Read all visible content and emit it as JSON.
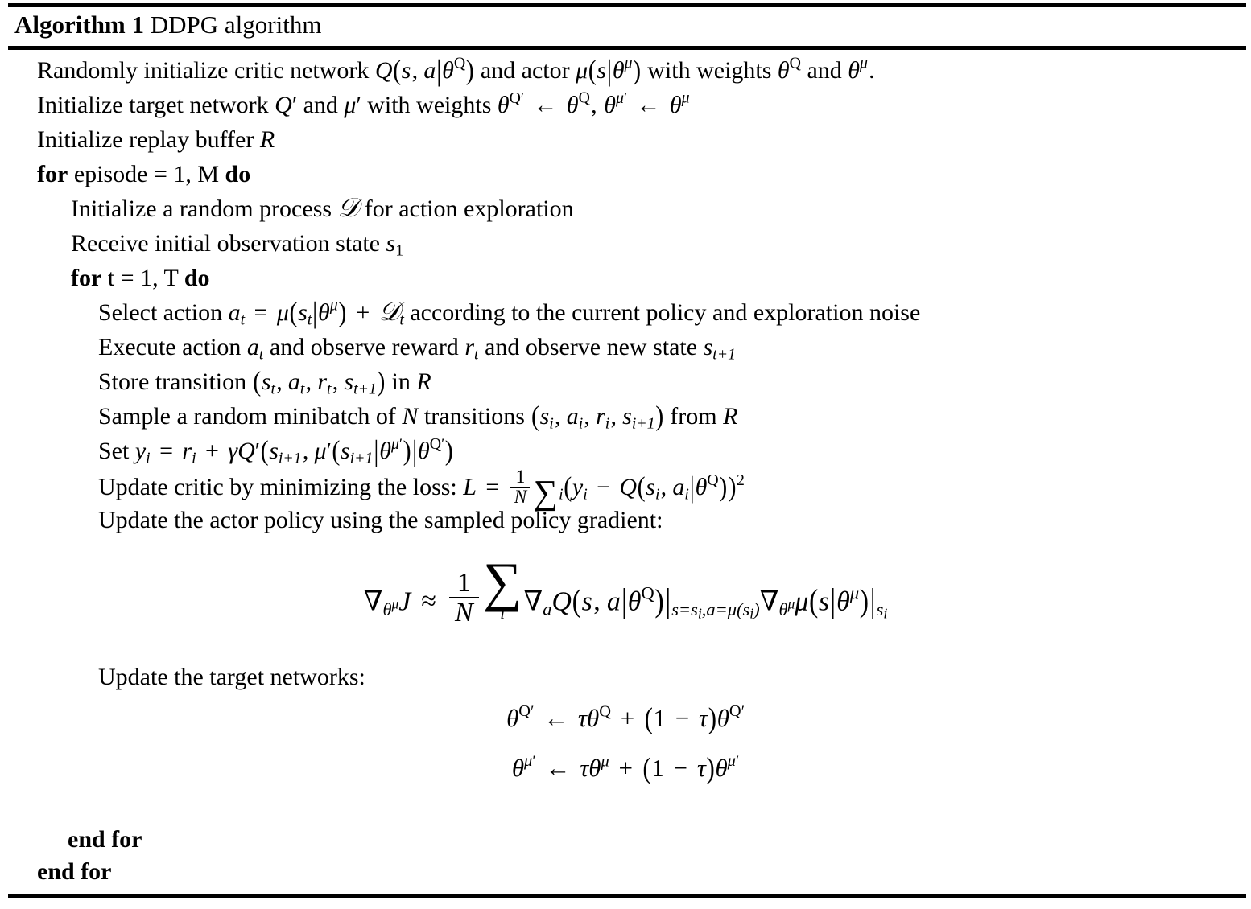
{
  "algorithm": {
    "number_label": "Algorithm 1",
    "title": "DDPG algorithm",
    "caption_full": "Algorithm 1 DDPG algorithm",
    "lines": [
      {
        "indent": 0,
        "id": "init-critic",
        "text": "Randomly initialize critic network Q(s, a|θ^Q) and actor μ(s|θ^μ) with weights θ^Q and θ^μ."
      },
      {
        "indent": 0,
        "id": "init-target",
        "text": "Initialize target network Q′ and μ′ with weights θ^Q′ ← θ^Q, θ^μ′ ← θ^μ"
      },
      {
        "indent": 0,
        "id": "init-replay",
        "text": "Initialize replay buffer R"
      },
      {
        "indent": 0,
        "id": "for-episode",
        "text": "for episode = 1, M do",
        "keywords": [
          "for",
          "do"
        ],
        "loop_var": "episode",
        "loop_from": "1",
        "loop_to": "M"
      },
      {
        "indent": 1,
        "id": "init-noise",
        "text": "Initialize a random process 𝒩 for action exploration"
      },
      {
        "indent": 1,
        "id": "receive-state",
        "text": "Receive initial observation state s₁"
      },
      {
        "indent": 1,
        "id": "for-t",
        "text": "for t = 1, T do",
        "keywords": [
          "for",
          "do"
        ],
        "loop_var": "t",
        "loop_from": "1",
        "loop_to": "T"
      },
      {
        "indent": 2,
        "id": "select-action",
        "text": "Select action a_t = μ(s_t|θ^μ) + 𝒩_t according to the current policy and exploration noise"
      },
      {
        "indent": 2,
        "id": "execute-action",
        "text": "Execute action a_t and observe reward r_t and observe new state s_{t+1}"
      },
      {
        "indent": 2,
        "id": "store-transition",
        "text": "Store transition (s_t, a_t, r_t, s_{t+1}) in R"
      },
      {
        "indent": 2,
        "id": "sample-minibatch",
        "text": "Sample a random minibatch of N transitions (s_i, a_i, r_i, s_{i+1}) from R"
      },
      {
        "indent": 2,
        "id": "set-y",
        "text": "Set y_i = r_i + γQ′(s_{i+1}, μ′(s_{i+1}|θ^μ′)|θ^Q′)"
      },
      {
        "indent": 2,
        "id": "update-critic",
        "text": "Update critic by minimizing the loss: L = (1/N) Σ_i (y_i − Q(s_i, a_i|θ^Q))²"
      },
      {
        "indent": 2,
        "id": "update-actor",
        "text": "Update the actor policy using the sampled policy gradient:"
      }
    ],
    "gradient_equation": "∇_{θ^μ} J ≈ (1/N) Σ_i ∇_a Q(s, a|θ^Q)|_{s=s_i, a=μ(s_i)} ∇_{θ^μ} μ(s|θ^μ)|_{s_i}",
    "update_target_label": "Update the target networks:",
    "target_equation_q": "θ^Q′ ← τθ^Q + (1 − τ)θ^Q′",
    "target_equation_mu": "θ^μ′ ← τθ^μ + (1 − τ)θ^μ′",
    "end_for_inner": "end for",
    "end_for_outer": "end for",
    "tokens": {
      "randomly_initialize_critic_network": "Randomly initialize critic network",
      "and_actor": "and actor",
      "with_weights": "with weights",
      "and": "and",
      "initialize_target_network": "Initialize target network",
      "initialize_replay_buffer": "Initialize replay buffer",
      "kw_for": "for",
      "kw_do": "do",
      "episode_eq": "episode = 1, M",
      "t_eq": "t = 1, T",
      "initialize_random_process": "Initialize a random process",
      "for_action_exploration": "for action exploration",
      "receive_initial_observation_state": "Receive initial observation state",
      "select_action": "Select action",
      "according_to_policy": "according to the current policy and exploration noise",
      "execute_action": "Execute action",
      "and_observe_reward": "and observe reward",
      "and_observe_new_state": "and observe new state",
      "store_transition": "Store transition",
      "in": "in",
      "sample_random_minibatch_of": "Sample a random minibatch of",
      "transitions": "transitions",
      "from": "from",
      "set": "Set",
      "update_critic_prefix": "Update critic by minimizing the loss:",
      "update_actor_text": "Update the actor policy using the sampled policy gradient:",
      "update_target_text": "Update the target networks:",
      "end_for": "end for"
    }
  },
  "colors": {
    "text": "#000000",
    "background": "#ffffff",
    "rule": "#000000"
  }
}
